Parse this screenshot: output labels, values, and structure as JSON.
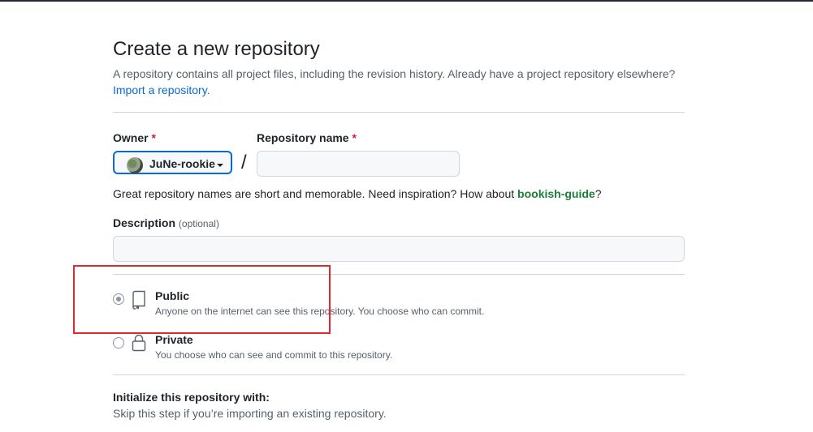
{
  "header": {
    "title": "Create a new repository",
    "subtitle": "A repository contains all project files, including the revision history. Already have a project repository elsewhere?",
    "import_link": "Import a repository."
  },
  "owner": {
    "label": "Owner",
    "required_mark": "*",
    "value": "JuNe-rookie"
  },
  "repo_name": {
    "label": "Repository name",
    "required_mark": "*",
    "value": "",
    "separator": "/"
  },
  "hint": {
    "text_before": "Great repository names are short and memorable. Need inspiration? How about ",
    "suggestion": "bookish-guide",
    "text_after": "?"
  },
  "description": {
    "label": "Description",
    "optional": "(optional)",
    "value": ""
  },
  "visibility": {
    "selected": "public",
    "options": [
      {
        "title": "Public",
        "desc": "Anyone on the internet can see this repository. You choose who can commit.",
        "icon": "repo-icon"
      },
      {
        "title": "Private",
        "desc": "You choose who can see and commit to this repository.",
        "icon": "lock-icon"
      }
    ]
  },
  "initialize": {
    "title": "Initialize this repository with:",
    "subtitle": "Skip this step if you’re importing an existing repository."
  },
  "colors": {
    "link": "#0969da",
    "suggestion": "#1a7f37",
    "required": "#cf222e",
    "highlight_box": "#e0282e"
  }
}
